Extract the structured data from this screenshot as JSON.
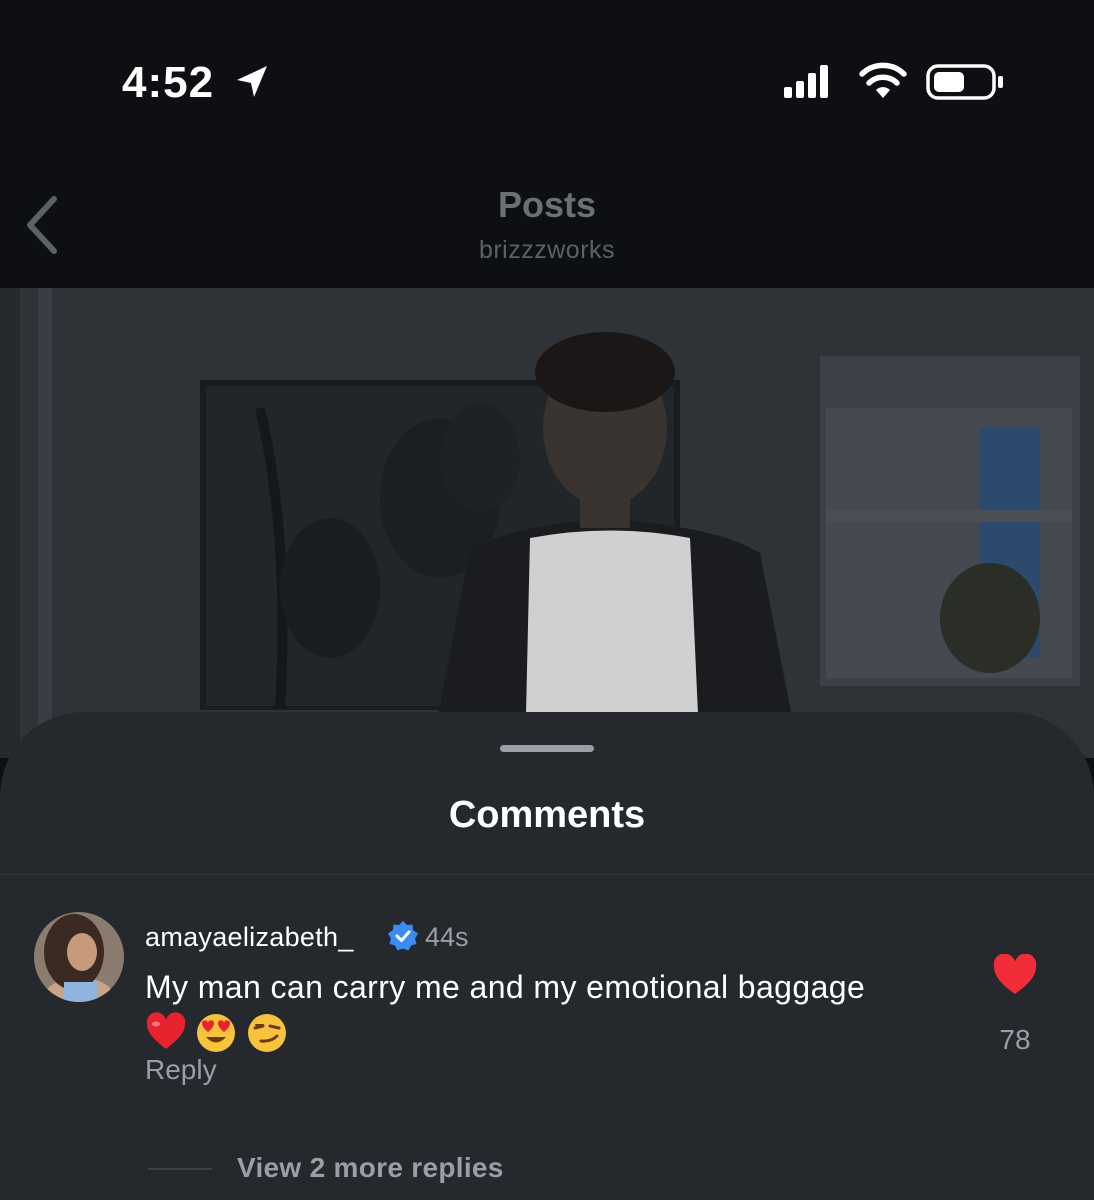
{
  "status_bar": {
    "time": "4:52",
    "icons": [
      "location-arrow-icon",
      "cellular-signal-icon",
      "wifi-icon",
      "battery-icon"
    ]
  },
  "header": {
    "title": "Posts",
    "subtitle": "brizzzworks",
    "back_icon": "chevron-left-icon"
  },
  "comments_sheet": {
    "title": "Comments",
    "comment": {
      "username": "amayaelizabeth_",
      "verified": true,
      "timestamp": "44s",
      "text": "My man can carry me and my emotional baggage",
      "emojis": [
        "red-heart-emoji",
        "heart-eyes-emoji",
        "smirk-emoji"
      ],
      "reply_label": "Reply",
      "like_count": "78",
      "liked": true,
      "view_replies_label": "View 2 more replies"
    }
  },
  "colors": {
    "background": "#0d0f12",
    "sheet": "#25282d",
    "like_red": "#f22d3a",
    "verified_blue": "#3b8cf0",
    "secondary_text": "#9a9ea5"
  }
}
